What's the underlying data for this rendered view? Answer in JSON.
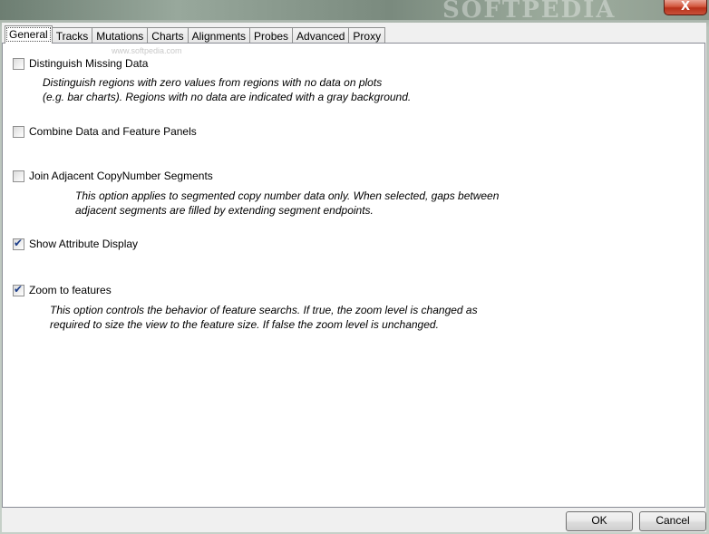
{
  "watermark": "SOFTPEDIA",
  "inner_watermark": "www.softpedia.com",
  "close_glyph": "X",
  "tabs": [
    {
      "label": "General",
      "active": true
    },
    {
      "label": "Tracks"
    },
    {
      "label": "Mutations"
    },
    {
      "label": "Charts"
    },
    {
      "label": "Alignments"
    },
    {
      "label": "Probes"
    },
    {
      "label": "Advanced"
    },
    {
      "label": "Proxy"
    }
  ],
  "options": {
    "missing_data": {
      "label": "Distinguish Missing Data",
      "checked": false,
      "desc1": "Distinguish regions with zero values from regions with no data on plots",
      "desc2": "(e.g. bar charts). Regions with no data are indicated with a gray background."
    },
    "combine_panels": {
      "label": "Combine Data and Feature Panels",
      "checked": false
    },
    "join_segments": {
      "label": "Join Adjacent CopyNumber Segments",
      "checked": false,
      "desc1": "This option applies to segmented copy number data only. When selected, gaps between",
      "desc2": "adjacent segments are filled by extending segment endpoints."
    },
    "attribute_display": {
      "label": "Show Attribute Display",
      "checked": true
    },
    "zoom_features": {
      "label": "Zoom to features",
      "checked": true,
      "desc1": "This option controls the behavior of feature searchs. If true, the zoom level is changed as",
      "desc2": "required to size the view to the feature size. If false the zoom level is unchanged."
    }
  },
  "buttons": {
    "ok": "OK",
    "cancel": "Cancel"
  },
  "check_glyph": "✔"
}
